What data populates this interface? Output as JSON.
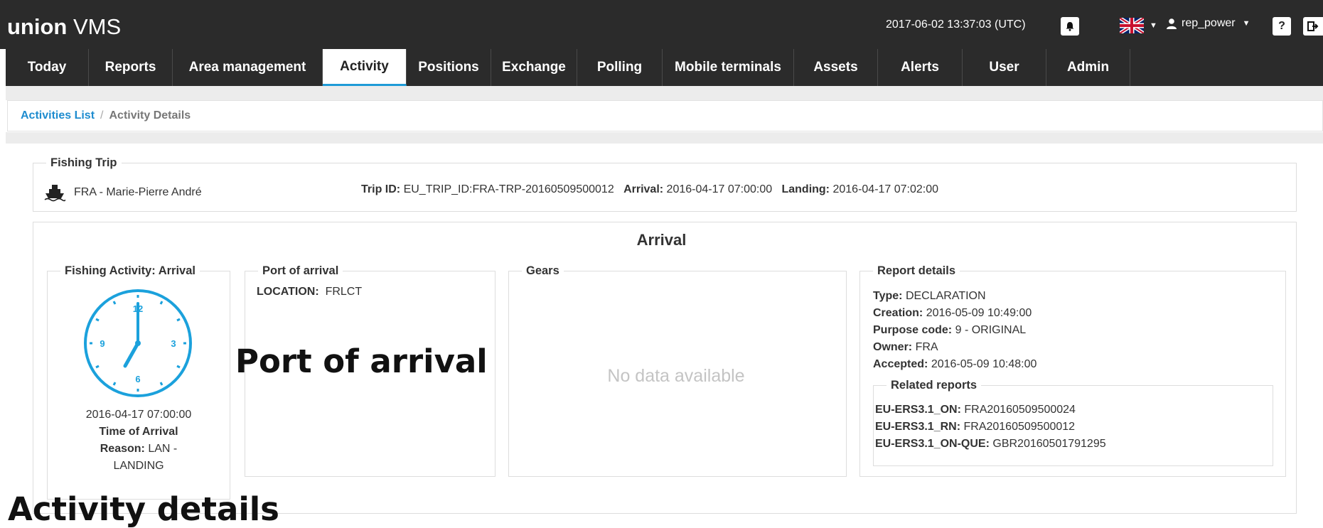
{
  "app": {
    "brand_bold": "union",
    "brand_light": " VMS"
  },
  "header": {
    "datetime": "2017-06-02 13:37:03 (UTC)",
    "username": "rep_power",
    "help_label": "?"
  },
  "nav": {
    "items": [
      {
        "label": "Today"
      },
      {
        "label": "Reports"
      },
      {
        "label": "Area management"
      },
      {
        "label": "Activity"
      },
      {
        "label": "Positions"
      },
      {
        "label": "Exchange"
      },
      {
        "label": "Polling"
      },
      {
        "label": "Mobile terminals"
      },
      {
        "label": "Assets"
      },
      {
        "label": "Alerts"
      },
      {
        "label": "User"
      },
      {
        "label": "Admin"
      }
    ],
    "active": "Activity"
  },
  "breadcrumb": {
    "link": "Activities List",
    "divider": "/",
    "current": "Activity Details"
  },
  "fishing_trip": {
    "legend": "Fishing Trip",
    "vessel": "FRA - Marie-Pierre André",
    "trip_id_label": "Trip ID:",
    "trip_id": "EU_TRIP_ID:FRA-TRP-20160509500012",
    "arrival_label": "Arrival:",
    "arrival": "2016-04-17 07:00:00",
    "landing_label": "Landing:",
    "landing": "2016-04-17 07:02:00"
  },
  "arrival_panel": {
    "title": "Arrival",
    "activity": {
      "legend": "Fishing Activity: Arrival",
      "datetime": "2016-04-17 07:00:00",
      "time_label": "Time of Arrival",
      "reason_label": "Reason:",
      "reason_value": "LAN -",
      "reason_value_2": "LANDING",
      "clock_numbers": [
        "12",
        "3",
        "6",
        "9"
      ]
    },
    "port": {
      "legend": "Port of arrival",
      "location_label": "LOCATION:",
      "location_value": "FRLCT"
    },
    "gears": {
      "legend": "Gears",
      "empty_text": "No data available"
    },
    "report": {
      "legend": "Report details",
      "type_label": "Type:",
      "type_value": "DECLARATION",
      "creation_label": "Creation:",
      "creation_value": "2016-05-09 10:49:00",
      "purpose_label": "Purpose code:",
      "purpose_value": "9 - ORIGINAL",
      "owner_label": "Owner:",
      "owner_value": "FRA",
      "accepted_label": "Accepted:",
      "accepted_value": "2016-05-09 10:48:00",
      "related": {
        "legend": "Related reports",
        "items": [
          {
            "label": "EU-ERS3.1_ON:",
            "value": "FRA20160509500024"
          },
          {
            "label": "EU-ERS3.1_RN:",
            "value": "FRA20160509500012"
          },
          {
            "label": "EU-ERS3.1_ON-QUE:",
            "value": "GBR20160501791295"
          }
        ]
      }
    }
  },
  "overlay_labels": {
    "port": "Port of arrival",
    "activity": "Activity details"
  },
  "colors": {
    "accent": "#1e9bd7",
    "topbar": "#2b2b2b",
    "clock": "#1ba1dc"
  }
}
